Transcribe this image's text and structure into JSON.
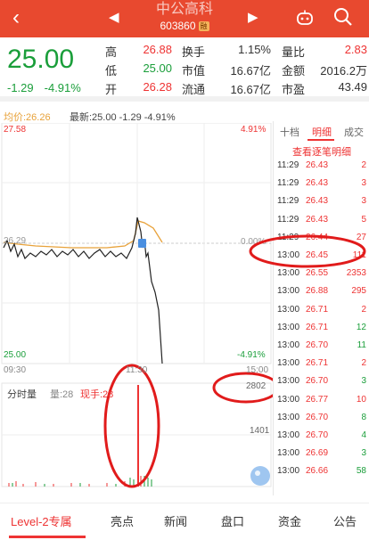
{
  "header": {
    "back_icon": "‹",
    "prev_icon": "◀",
    "next_icon": "▶",
    "stock_name": "中公高科",
    "stock_code": "603860",
    "badge": "融"
  },
  "quote": {
    "price": "25.00",
    "change": "-1.29",
    "change_pct": "-4.91%",
    "rows": [
      {
        "k1": "高",
        "v1": "26.88",
        "k2": "换手",
        "v2": "1.15%",
        "k3": "量比",
        "v3": "2.83"
      },
      {
        "k1": "低",
        "v1": "25.00",
        "k2": "市值",
        "v2": "16.67亿",
        "k3": "金额",
        "v3": "2016.2万"
      },
      {
        "k1": "开",
        "v1": "26.28",
        "k2": "流通",
        "v2": "16.67亿",
        "k3": "市盈",
        "v3": "43.49"
      }
    ]
  },
  "infobar": {
    "avg": "均价:26.26",
    "latest": "最新:25.00 -1.29 -4.91%"
  },
  "chart_labels": {
    "top_price": "27.58",
    "top_pct": "4.91%",
    "mid_price": "26.29",
    "mid_pct": "0.00%",
    "bottom_price": "25.00",
    "bottom_pct": "-4.91%",
    "time_start": "09:30",
    "time_mid": "11:30",
    "time_end": "15:00",
    "vol_title": "分时量",
    "vol_amount": "量:28",
    "vol_now": "现手:28",
    "vol_max": "2802",
    "vol_mid": "1401"
  },
  "right_panel": {
    "tabs": [
      "十档",
      "明细",
      "成交"
    ],
    "detail_link": "查看逐笔明细",
    "trades": [
      {
        "time": "11:29",
        "price": "26.43",
        "qty": "2",
        "pc": "red",
        "qc": "red"
      },
      {
        "time": "11:29",
        "price": "26.43",
        "qty": "3",
        "pc": "red",
        "qc": "red"
      },
      {
        "time": "11:29",
        "price": "26.43",
        "qty": "3",
        "pc": "red",
        "qc": "red"
      },
      {
        "time": "11:29",
        "price": "26.43",
        "qty": "5",
        "pc": "red",
        "qc": "red"
      },
      {
        "time": "11:29",
        "price": "26.44",
        "qty": "27",
        "pc": "red",
        "qc": "red"
      },
      {
        "time": "13:00",
        "price": "26.45",
        "qty": "111",
        "pc": "red",
        "qc": "red"
      },
      {
        "time": "13:00",
        "price": "26.55",
        "qty": "2353",
        "pc": "red",
        "qc": "red"
      },
      {
        "time": "13:00",
        "price": "26.88",
        "qty": "295",
        "pc": "red",
        "qc": "red"
      },
      {
        "time": "13:00",
        "price": "26.71",
        "qty": "2",
        "pc": "red",
        "qc": "red"
      },
      {
        "time": "13:00",
        "price": "26.71",
        "qty": "12",
        "pc": "red",
        "qc": "grn"
      },
      {
        "time": "13:00",
        "price": "26.70",
        "qty": "11",
        "pc": "red",
        "qc": "grn"
      },
      {
        "time": "13:00",
        "price": "26.71",
        "qty": "2",
        "pc": "red",
        "qc": "red"
      },
      {
        "time": "13:00",
        "price": "26.70",
        "qty": "3",
        "pc": "red",
        "qc": "grn"
      },
      {
        "time": "13:00",
        "price": "26.77",
        "qty": "10",
        "pc": "red",
        "qc": "red"
      },
      {
        "time": "13:00",
        "price": "26.70",
        "qty": "8",
        "pc": "red",
        "qc": "grn"
      },
      {
        "time": "13:00",
        "price": "26.70",
        "qty": "4",
        "pc": "red",
        "qc": "grn"
      },
      {
        "time": "13:00",
        "price": "26.69",
        "qty": "3",
        "pc": "red",
        "qc": "grn"
      },
      {
        "time": "13:00",
        "price": "26.66",
        "qty": "58",
        "pc": "red",
        "qc": "grn"
      }
    ]
  },
  "bottom_tabs": [
    "Level-2专属",
    "亮点",
    "新闻",
    "盘口",
    "资金",
    "公告"
  ],
  "colors": {
    "brand": "#e8492f",
    "up": "#e33333",
    "down": "#1a9e3a",
    "avg_line": "#e8a23a",
    "annotation": "#e11b1b"
  }
}
